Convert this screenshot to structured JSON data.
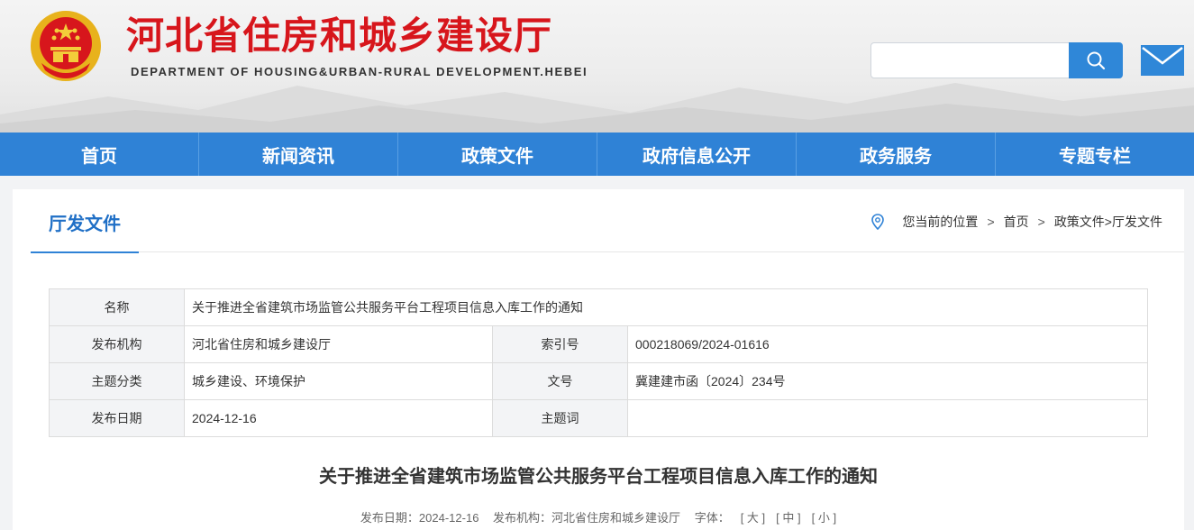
{
  "header": {
    "title": "河北省住房和城乡建设厅",
    "subtitle": "DEPARTMENT OF HOUSING&URBAN-RURAL DEVELOPMENT.HEBEI",
    "search_placeholder": ""
  },
  "nav": {
    "items": [
      "首页",
      "新闻资讯",
      "政策文件",
      "政府信息公开",
      "政务服务",
      "专题专栏"
    ]
  },
  "section": {
    "title": "厅发文件"
  },
  "breadcrumb": {
    "prefix": "您当前的位置",
    "home": "首页",
    "path": "政策文件>厅发文件"
  },
  "meta": {
    "name_label": "名称",
    "name_value": "关于推进全省建筑市场监管公共服务平台工程项目信息入库工作的通知",
    "publisher_label": "发布机构",
    "publisher_value": "河北省住房和城乡建设厅",
    "index_label": "索引号",
    "index_value": "000218069/2024-01616",
    "category_label": "主题分类",
    "category_value": "城乡建设、环境保护",
    "docno_label": "文号",
    "docno_value": "冀建建市函〔2024〕234号",
    "date_label": "发布日期",
    "date_value": "2024-12-16",
    "keyword_label": "主题词",
    "keyword_value": ""
  },
  "article": {
    "title": "关于推进全省建筑市场监管公共服务平台工程项目信息入库工作的通知",
    "date_text": "发布日期：2024-12-16",
    "org_text": "发布机构：河北省住房和城乡建设厅",
    "font_label": "字体：",
    "font_large": "[ 大 ]",
    "font_medium": "[ 中 ]",
    "font_small": "[ 小 ]"
  },
  "colors": {
    "brand_red": "#d7161c",
    "nav_blue": "#2f82d6"
  },
  "icons": [
    "national-emblem-icon",
    "search-icon",
    "mail-icon",
    "location-pin-icon"
  ]
}
